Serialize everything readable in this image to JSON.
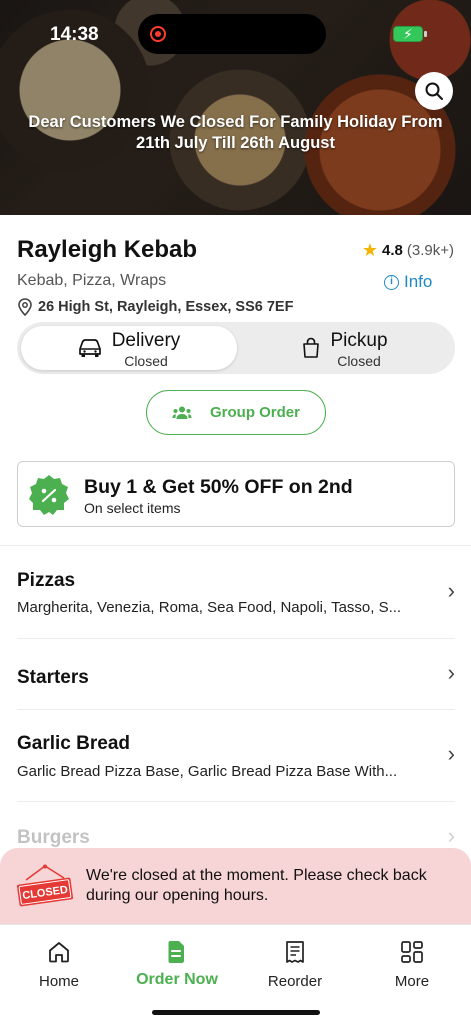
{
  "status_bar": {
    "time": "14:38"
  },
  "hero": {
    "notice": "Dear Customers We Closed For Family Holiday From 21th July Till 26th August"
  },
  "restaurant": {
    "name": "Rayleigh Kebab",
    "rating": "4.8",
    "rating_count": "(3.9k+)",
    "cuisines": "Kebab, Pizza, Wraps",
    "info_label": "Info",
    "address": "26 High St, Rayleigh, Essex, SS6 7EF"
  },
  "order_mode": {
    "delivery": {
      "label": "Delivery",
      "status": "Closed",
      "selected": true
    },
    "pickup": {
      "label": "Pickup",
      "status": "Closed",
      "selected": false
    }
  },
  "group_order": {
    "label": "Group Order"
  },
  "promo": {
    "title": "Buy 1 & Get 50% OFF on 2nd",
    "subtitle": "On select items"
  },
  "categories": [
    {
      "title": "Pizzas",
      "description": "Margherita, Venezia, Roma, Sea Food, Napoli, Tasso, S..."
    },
    {
      "title": "Starters",
      "description": ""
    },
    {
      "title": "Garlic Bread",
      "description": "Garlic Bread Pizza Base, Garlic Bread Pizza Base With..."
    },
    {
      "title": "Burgers",
      "description": ""
    }
  ],
  "closed_banner": {
    "sign": "CLOSED",
    "message": "We're closed at the moment. Please check back during our opening hours."
  },
  "nav": {
    "items": [
      {
        "label": "Home",
        "icon": "home-icon"
      },
      {
        "label": "Order Now",
        "icon": "order-icon",
        "active": true
      },
      {
        "label": "Reorder",
        "icon": "receipt-icon"
      },
      {
        "label": "More",
        "icon": "grid-icon"
      }
    ]
  },
  "colors": {
    "accent_green": "#4caf50",
    "link_blue": "#1e88c8",
    "closed_bg": "#f7d4d5",
    "closed_red": "#e53935",
    "star": "#f4b400"
  }
}
